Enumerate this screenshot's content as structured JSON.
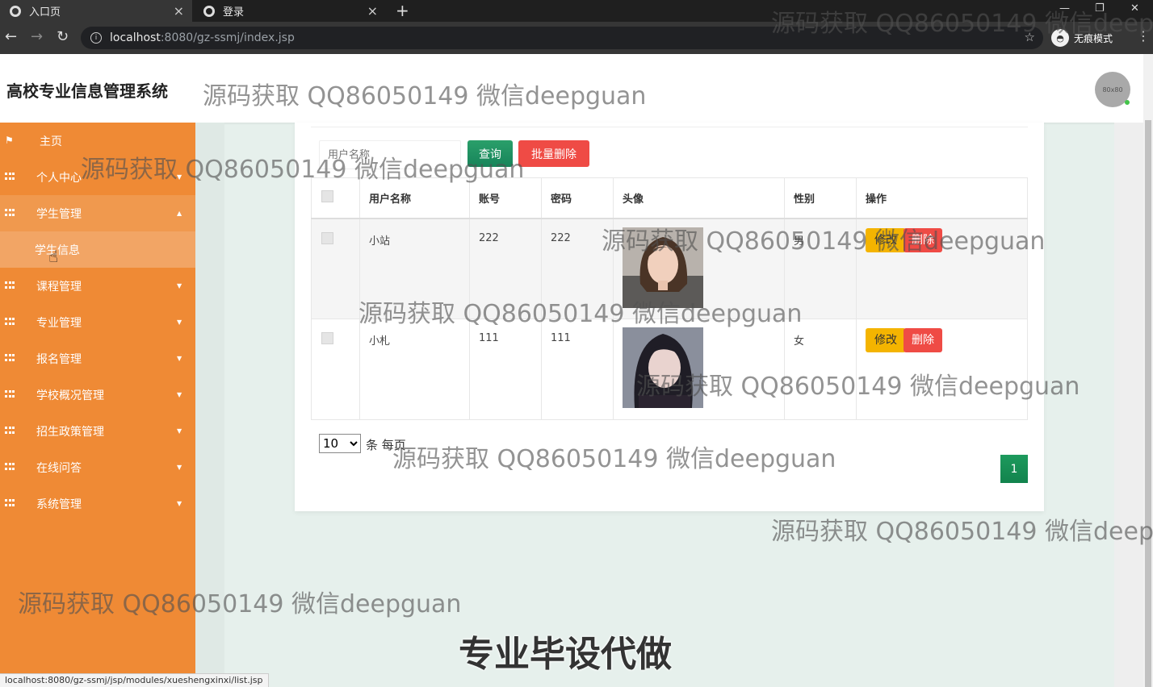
{
  "browser": {
    "tabs": [
      {
        "label": "入口页",
        "active": true
      },
      {
        "label": "登录",
        "active": false
      }
    ],
    "url_host": "localhost",
    "url_rest": ":8080/gz-ssmj/index.jsp",
    "incognito_label": "无痕模式",
    "status_url": "localhost:8080/gz-ssmj/jsp/modules/xueshengxinxi/list.jsp"
  },
  "header": {
    "title": "高校专业信息管理系统",
    "avatar_text": "80x80"
  },
  "sidebar": {
    "items": [
      {
        "label": "主页",
        "icon": "flag-icon"
      },
      {
        "label": "个人中心",
        "icon": "grid-icon"
      },
      {
        "label": "学生管理",
        "icon": "grid-icon",
        "expanded": true
      },
      {
        "label": "学生信息",
        "submenu": true
      },
      {
        "label": "课程管理",
        "icon": "grid-icon"
      },
      {
        "label": "专业管理",
        "icon": "grid-icon"
      },
      {
        "label": "报名管理",
        "icon": "grid-icon"
      },
      {
        "label": "学校概况管理",
        "icon": "grid-icon"
      },
      {
        "label": "招生政策管理",
        "icon": "grid-icon"
      },
      {
        "label": "在线问答",
        "icon": "grid-icon"
      },
      {
        "label": "系统管理",
        "icon": "grid-icon"
      }
    ]
  },
  "toolbar": {
    "search_placeholder": "用户名称",
    "query_label": "查询",
    "batch_delete_label": "批量删除"
  },
  "table": {
    "columns": [
      "",
      "用户名称",
      "账号",
      "密码",
      "头像",
      "性别",
      "操作"
    ],
    "rows": [
      {
        "name": "小站",
        "account": "222",
        "password": "222",
        "gender": "男"
      },
      {
        "name": "小札",
        "account": "111",
        "password": "111",
        "gender": "女"
      }
    ],
    "edit_label": "修改",
    "delete_label": "删除"
  },
  "pagination": {
    "page_size": "10",
    "page_size_options": [
      "10"
    ],
    "page_size_label": "条 每页",
    "current_page": "1"
  },
  "watermarks": {
    "text": "源码获取 QQ86050149 微信deepguan",
    "big": "专业毕设代做"
  },
  "colors": {
    "sidebar": "#ef8a35",
    "query_button": "#1d9a5d",
    "delete_button": "#ef4b45",
    "edit_button": "#f4b400"
  }
}
